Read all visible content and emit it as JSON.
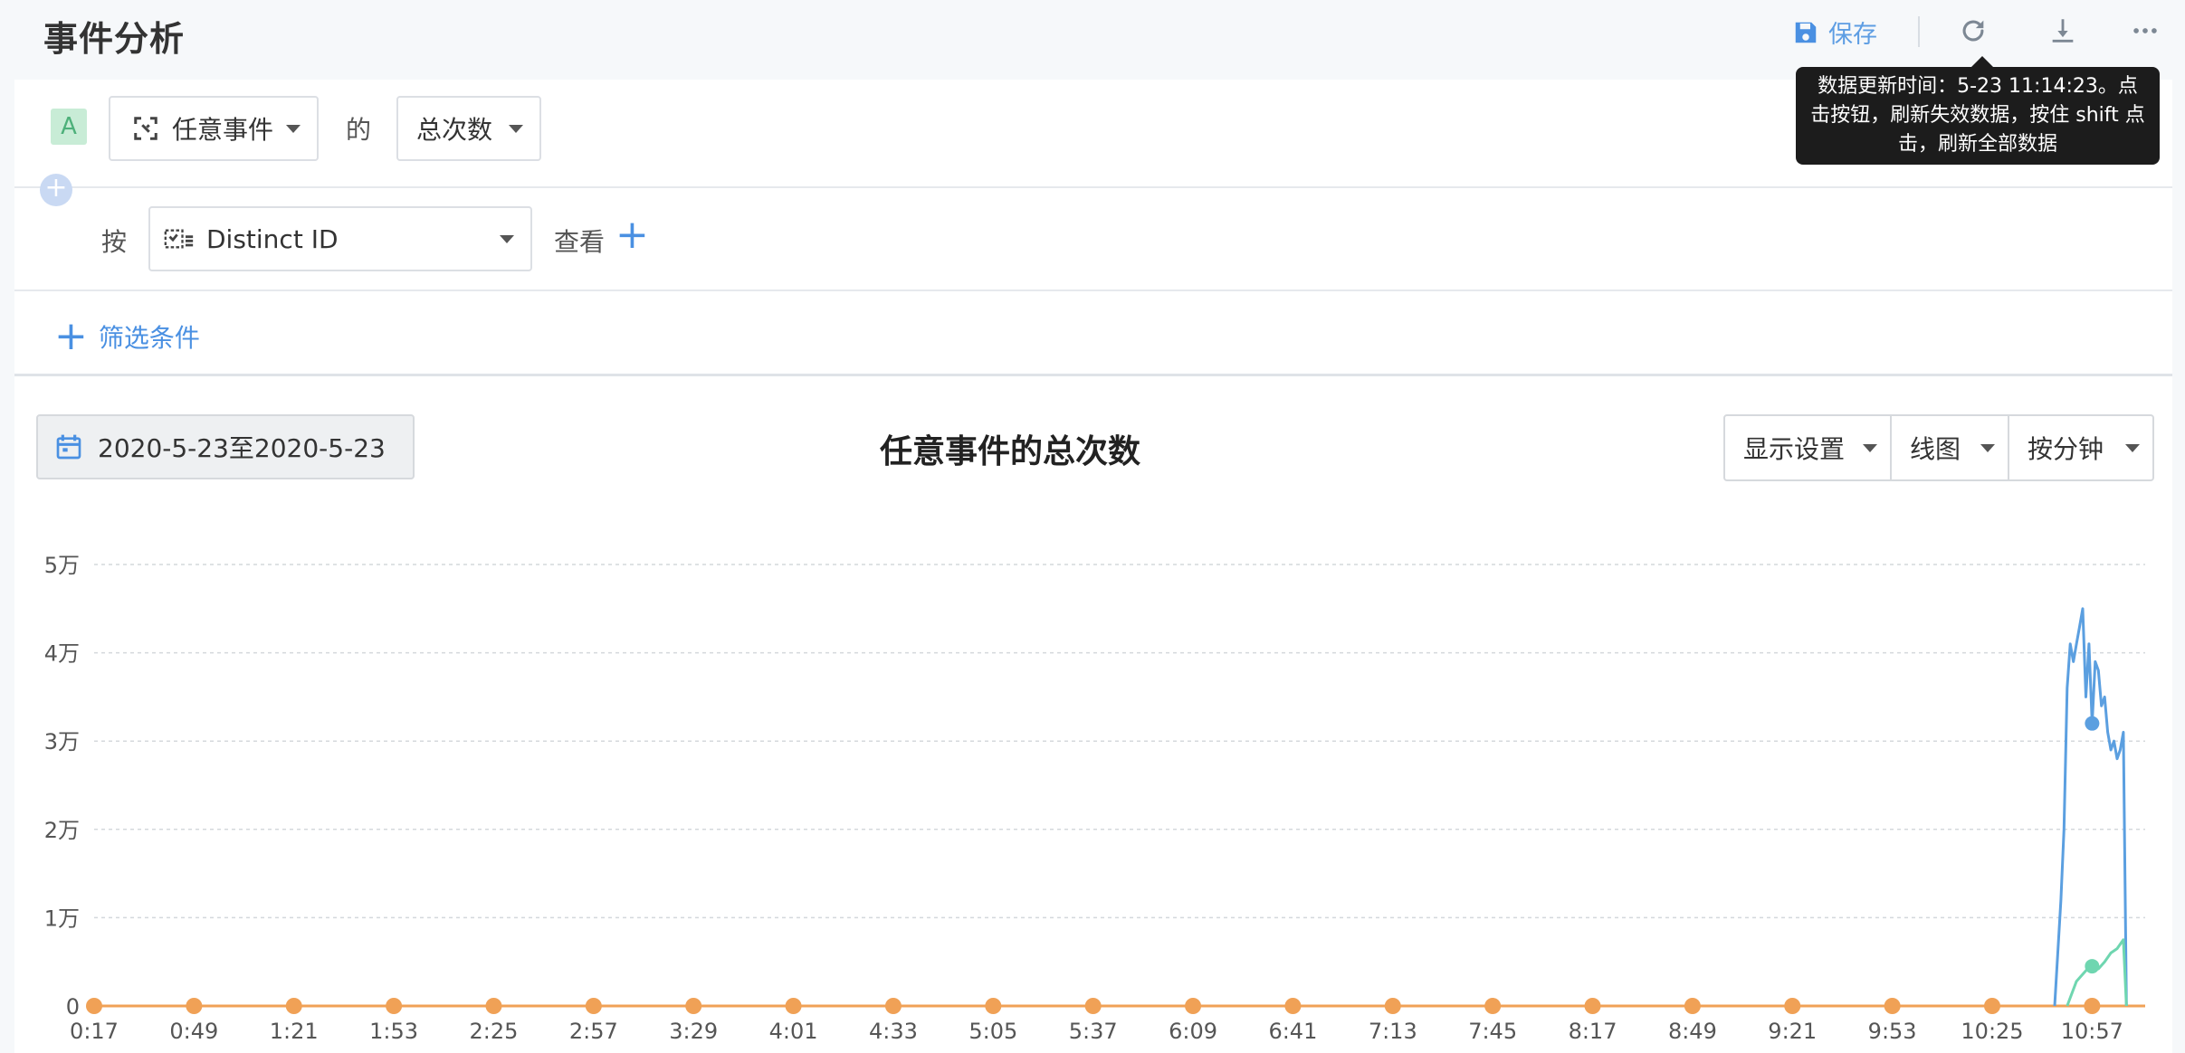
{
  "header": {
    "title": "事件分析",
    "save_label": "保存",
    "refresh_icon": "refresh-icon",
    "download_icon": "download-icon",
    "more_icon": "more-icon",
    "tooltip": "数据更新时间：5-23 11:14:23。点击按钮，刷新失效数据，按住 shift 点击，刷新全部数据"
  },
  "query": {
    "badge": "A",
    "event_select": "任意事件",
    "of_label": "的",
    "metric_select": "总次数",
    "by_label": "按",
    "group_select": "Distinct ID",
    "view_label": "查看",
    "filter_label": "筛选条件"
  },
  "toolbar": {
    "date_range": "2020-5-23至2020-5-23",
    "display_settings": "显示设置",
    "chart_type": "线图",
    "granularity": "按分钟"
  },
  "colors": {
    "accent": "#4a90e2",
    "series_blue": "#5b9fe0",
    "series_green": "#6fd6b0",
    "series_orange": "#f0a156"
  },
  "chart_data": {
    "type": "line",
    "title": "任意事件的总次数",
    "y_ticks": [
      "0",
      "1万",
      "2万",
      "3万",
      "4万",
      "5万"
    ],
    "ylim": [
      0,
      50000
    ],
    "x_ticks": [
      "0:17",
      "0:49",
      "1:21",
      "1:53",
      "2:25",
      "2:57",
      "3:29",
      "4:01",
      "4:33",
      "5:05",
      "5:37",
      "6:09",
      "6:41",
      "7:13",
      "7:45",
      "8:17",
      "8:49",
      "9:21",
      "9:53",
      "10:25",
      "10:57"
    ],
    "x_range": [
      "0:17",
      "11:14"
    ],
    "grid": true,
    "series": [
      {
        "color": "#f0a156",
        "points": [
          [
            "0:17",
            0
          ],
          [
            "0:49",
            0
          ],
          [
            "1:21",
            0
          ],
          [
            "1:53",
            0
          ],
          [
            "2:25",
            0
          ],
          [
            "2:57",
            0
          ],
          [
            "3:29",
            0
          ],
          [
            "4:01",
            0
          ],
          [
            "4:33",
            0
          ],
          [
            "5:05",
            0
          ],
          [
            "5:37",
            0
          ],
          [
            "6:09",
            0
          ],
          [
            "6:41",
            0
          ],
          [
            "7:13",
            0
          ],
          [
            "7:45",
            0
          ],
          [
            "8:17",
            0
          ],
          [
            "8:49",
            0
          ],
          [
            "9:21",
            0
          ],
          [
            "9:53",
            0
          ],
          [
            "10:25",
            0
          ],
          [
            "10:57",
            0
          ],
          [
            "11:14",
            0
          ]
        ],
        "markers": [
          "0:17",
          "0:49",
          "1:21",
          "1:53",
          "2:25",
          "2:57",
          "3:29",
          "4:01",
          "4:33",
          "5:05",
          "5:37",
          "6:09",
          "6:41",
          "7:13",
          "7:45",
          "8:17",
          "8:49",
          "9:21",
          "9:53",
          "10:25",
          "10:57"
        ]
      },
      {
        "color": "#5b9fe0",
        "points": [
          [
            "10:45",
            0
          ],
          [
            "10:47",
            12000
          ],
          [
            "10:48",
            20000
          ],
          [
            "10:49",
            36000
          ],
          [
            "10:50",
            41000
          ],
          [
            "10:51",
            39000
          ],
          [
            "10:52",
            41000
          ],
          [
            "10:53",
            43000
          ],
          [
            "10:54",
            45000
          ],
          [
            "10:55",
            35000
          ],
          [
            "10:56",
            41000
          ],
          [
            "10:57",
            32000
          ],
          [
            "10:58",
            39000
          ],
          [
            "10:59",
            38000
          ],
          [
            "11:00",
            34000
          ],
          [
            "11:01",
            35000
          ],
          [
            "11:02",
            31000
          ],
          [
            "11:03",
            29000
          ],
          [
            "11:04",
            30000
          ],
          [
            "11:05",
            28000
          ],
          [
            "11:06",
            29000
          ],
          [
            "11:07",
            31000
          ],
          [
            "11:08",
            0
          ]
        ],
        "markers": [
          "10:57"
        ]
      },
      {
        "color": "#6fd6b0",
        "points": [
          [
            "10:49",
            0
          ],
          [
            "10:52",
            2800
          ],
          [
            "10:55",
            4000
          ],
          [
            "10:57",
            4500
          ],
          [
            "10:59",
            4200
          ],
          [
            "11:01",
            5000
          ],
          [
            "11:03",
            6000
          ],
          [
            "11:05",
            6500
          ],
          [
            "11:07",
            7500
          ],
          [
            "11:08",
            0
          ]
        ],
        "markers": [
          "10:57"
        ]
      }
    ]
  }
}
